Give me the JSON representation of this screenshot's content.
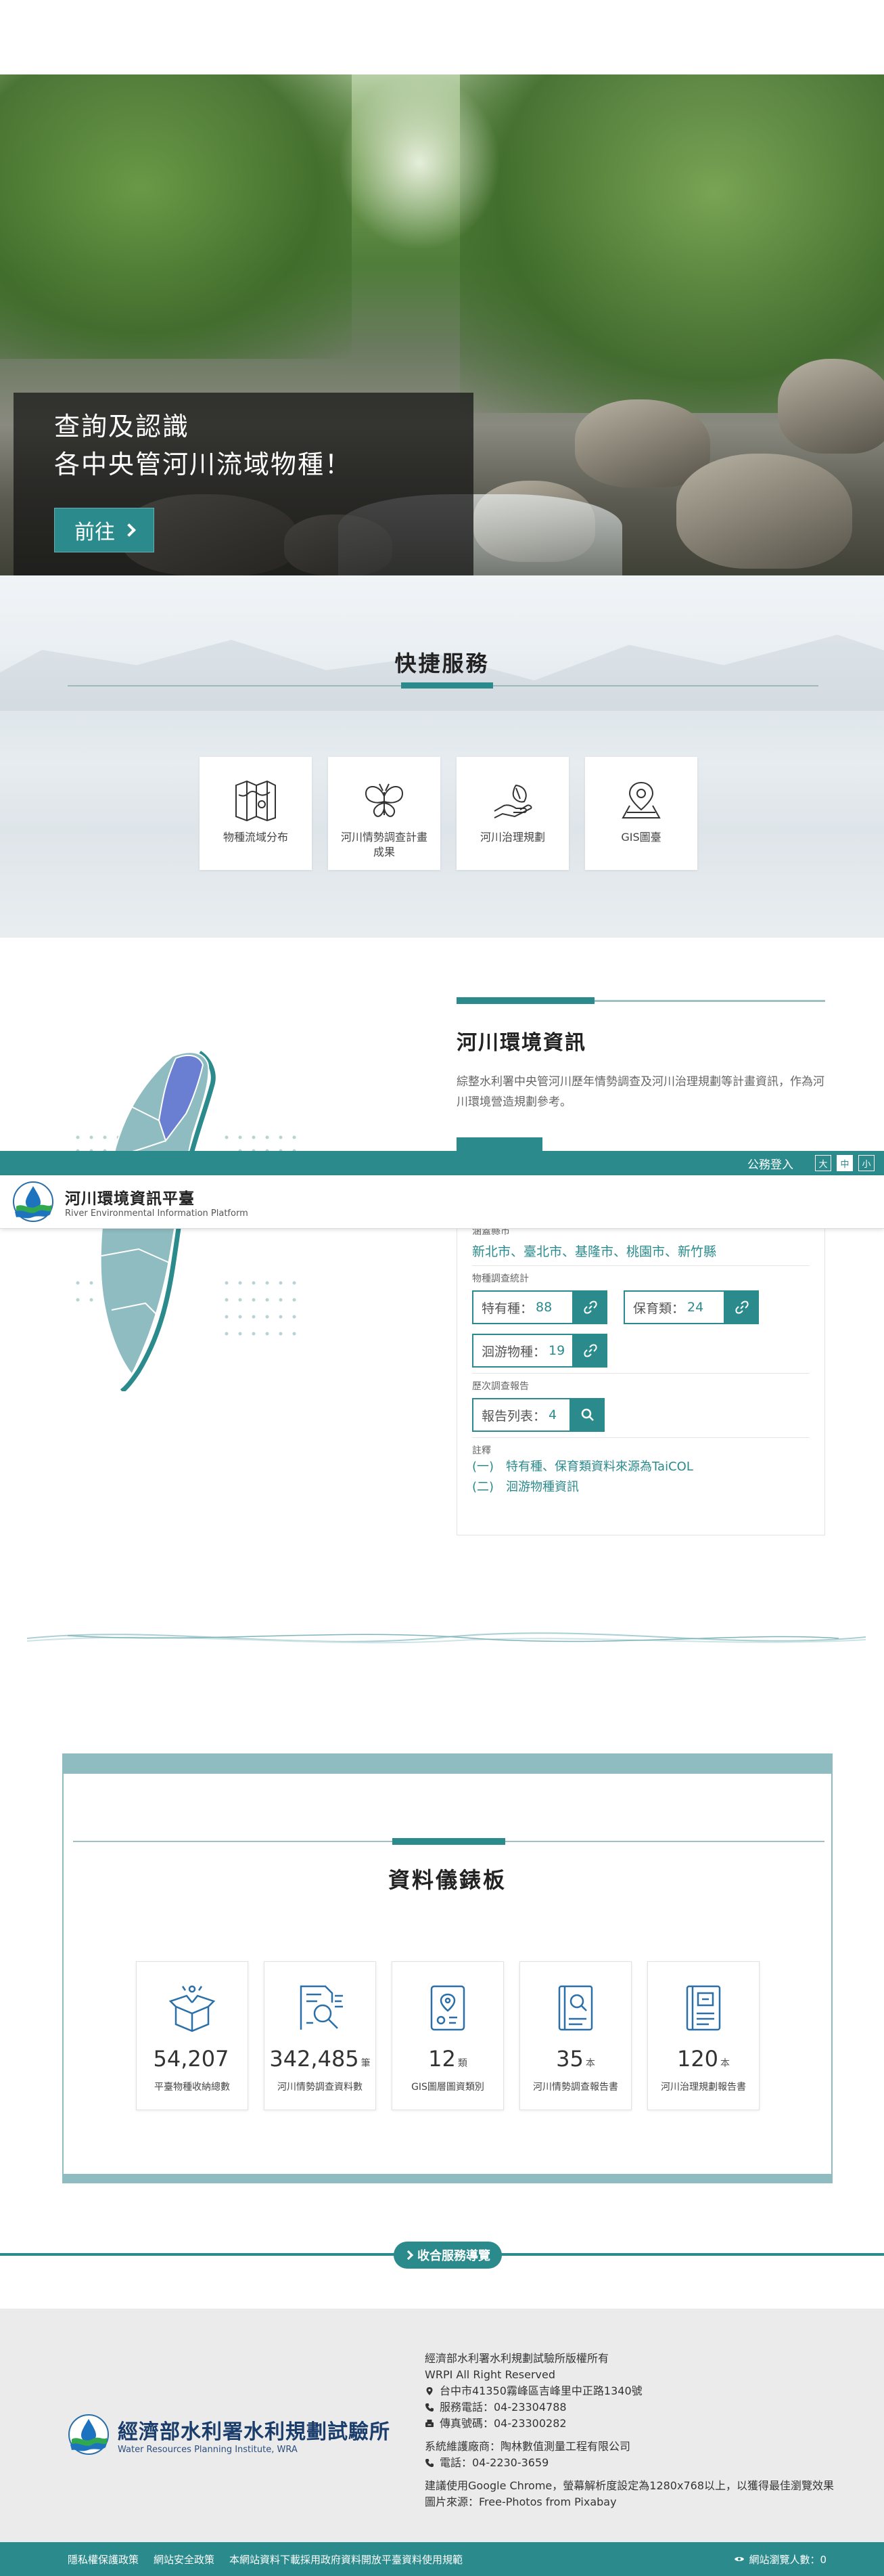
{
  "hero": {
    "line1": "查詢及認識",
    "line2": "各中央管河川流域物種！",
    "button_label": "前往"
  },
  "quick_services": {
    "title": "快捷服務",
    "items": [
      {
        "label": "物種流域分布",
        "icon": "map-icon"
      },
      {
        "label": "河川情勢調查計畫成果",
        "icon": "butterfly-icon"
      },
      {
        "label": "河川治理規劃",
        "icon": "leaf-hand-icon"
      },
      {
        "label": "GIS圖臺",
        "icon": "map-pin-icon"
      }
    ]
  },
  "river_env": {
    "title": "河川環境資訊",
    "description": "綜整水利署中央管河川歷年情勢調查及河川治理規劃等計畫資訊，作為河川環境營造規劃參考。",
    "jurisdiction_label": "涵蓋縣市",
    "cities": "新北市、臺北市、基隆市、桃園市、新竹縣",
    "survey_stats_label": "物種調查統計",
    "stats": [
      {
        "label": "特有種：",
        "value": "88"
      },
      {
        "label": "保育類：",
        "value": "24"
      },
      {
        "label": "洄游物種：",
        "value": "19"
      }
    ],
    "history_label": "歷次調查報告",
    "report": {
      "label": "報告列表：",
      "value": "4"
    },
    "notes_label": "註釋",
    "notes": [
      "(一)　特有種、保育類資料來源為TaiCOL",
      "(二)　洄游物種資訊"
    ]
  },
  "dashboard": {
    "title": "資料儀錶板",
    "items": [
      {
        "value": "54,207",
        "unit": "",
        "caption": "平臺物種收納總數",
        "icon": "box-icon"
      },
      {
        "value": "342,485",
        "unit": "筆",
        "caption": "河川情勢調查資料數",
        "icon": "data-search-icon"
      },
      {
        "value": "12",
        "unit": "類",
        "caption": "GIS圖層圖資類別",
        "icon": "map-layer-icon"
      },
      {
        "value": "35",
        "unit": "本",
        "caption": "河川情勢調查報告書",
        "icon": "report-search-icon"
      },
      {
        "value": "120",
        "unit": "本",
        "caption": "河川治理規劃報告書",
        "icon": "report-icon"
      }
    ]
  },
  "combo_nav": {
    "label": "收合服務導覽"
  },
  "header": {
    "login": "公務登入",
    "font_sizes": [
      "大",
      "中",
      "小"
    ],
    "site_name": "河川環境資訊平臺",
    "site_name_en": "River Environmental Information Platform"
  },
  "footer": {
    "org_name": "經濟部水利署水利規劃試驗所",
    "org_name_en": "Water Resources Planning Institute, WRA",
    "copyright": "經濟部水利署水利規劃試驗所版權所有",
    "rights": "WRPI All Right Reserved",
    "address": "台中市41350霧峰區吉峰里中正路1340號",
    "phone": "服務電話：04-23304788",
    "fax": "傳真號碼：04-23300282",
    "maintainer": "系統維護廠商：陶林數值測量工程有限公司",
    "maintainer_phone": "電話：04-2230-3659",
    "browser_note": "建議使用Google Chrome，螢幕解析度設定為1280x768以上，以獲得最佳瀏覽效果",
    "image_source": "圖片來源：Free-Photos from Pixabay",
    "links": [
      "隱私權保護政策",
      "網站安全政策",
      "本網站資料下載採用政府資料開放平臺資料使用規範"
    ],
    "visits_label": "網站瀏覽人數：0"
  },
  "colors": {
    "accent": "#2a8a8c",
    "accent_light": "#8fbcc0",
    "map_fill": "#8fbcc0",
    "map_highlight": "#6a7fd1"
  }
}
